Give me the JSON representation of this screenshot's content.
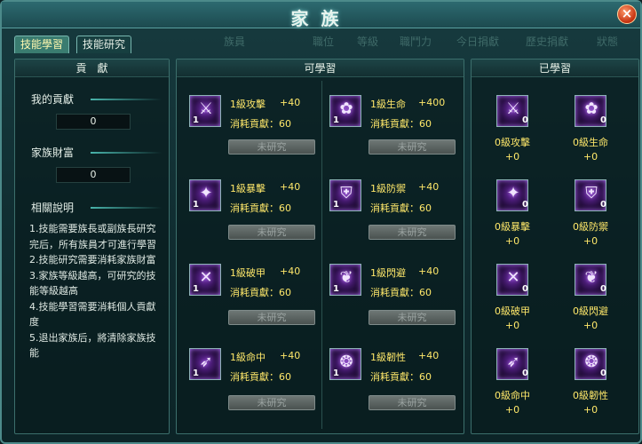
{
  "window": {
    "title": "家族",
    "close_label": "×"
  },
  "tabs": [
    {
      "label": "技能學習",
      "active": true
    },
    {
      "label": "技能研究",
      "active": false
    }
  ],
  "header_columns": [
    "族員",
    "職位",
    "等級",
    "職鬥力",
    "今日捐獻",
    "歷史捐獻",
    "狀態"
  ],
  "left": {
    "title": "貢　獻",
    "my_contribution_label": "我的貢獻",
    "my_contribution_value": "0",
    "family_wealth_label": "家族財富",
    "family_wealth_value": "0",
    "notes_label": "相關說明",
    "notes": [
      "1.技能需要族長或副族長研究完后，所有族員才可進行學習",
      "2.技能研究需要消耗家族財富",
      "3.家族等級越高，可研究的技能等級越高",
      "4.技能學習需要消耗個人貢獻度",
      "5.退出家族后，將清除家族技能"
    ]
  },
  "learnable": {
    "title": "可學習",
    "cost_label": "消耗貢獻：60",
    "button_label": "未研究",
    "skills": [
      {
        "name": "1級攻擊",
        "bonus": "+40",
        "count": "1",
        "glyph": "⚔",
        "icon": "blade-icon"
      },
      {
        "name": "1級生命",
        "bonus": "+400",
        "count": "1",
        "glyph": "✿",
        "icon": "heart-orb-icon"
      },
      {
        "name": "1級暴擊",
        "bonus": "+40",
        "count": "1",
        "glyph": "✦",
        "icon": "crit-icon"
      },
      {
        "name": "1級防禦",
        "bonus": "+40",
        "count": "1",
        "glyph": "⛨",
        "icon": "armor-icon"
      },
      {
        "name": "1級破甲",
        "bonus": "+40",
        "count": "1",
        "glyph": "✕",
        "icon": "pierce-icon"
      },
      {
        "name": "1級閃避",
        "bonus": "+40",
        "count": "1",
        "glyph": "❦",
        "icon": "wing-icon"
      },
      {
        "name": "1級命中",
        "bonus": "+40",
        "count": "1",
        "glyph": "➶",
        "icon": "hit-icon"
      },
      {
        "name": "1級韌性",
        "bonus": "+40",
        "count": "1",
        "glyph": "❂",
        "icon": "star-shield-icon"
      }
    ]
  },
  "learned": {
    "title": "已學習",
    "skills": [
      {
        "name": "0級攻擊",
        "bonus": "+0",
        "count": "0",
        "glyph": "⚔",
        "icon": "blade-icon"
      },
      {
        "name": "0級生命",
        "bonus": "+0",
        "count": "0",
        "glyph": "✿",
        "icon": "heart-orb-icon"
      },
      {
        "name": "0級暴擊",
        "bonus": "+0",
        "count": "0",
        "glyph": "✦",
        "icon": "crit-icon"
      },
      {
        "name": "0級防禦",
        "bonus": "+0",
        "count": "0",
        "glyph": "⛨",
        "icon": "armor-icon"
      },
      {
        "name": "0級破甲",
        "bonus": "+0",
        "count": "0",
        "glyph": "✕",
        "icon": "pierce-icon"
      },
      {
        "name": "0級閃避",
        "bonus": "+0",
        "count": "0",
        "glyph": "❦",
        "icon": "wing-icon"
      },
      {
        "name": "0級命中",
        "bonus": "+0",
        "count": "0",
        "glyph": "➶",
        "icon": "hit-icon"
      },
      {
        "name": "0級韌性",
        "bonus": "+0",
        "count": "0",
        "glyph": "❂",
        "icon": "star-shield-icon"
      }
    ]
  },
  "colors": {
    "accent": "#ffe86a",
    "panel_border": "#3c6f6c",
    "tab_active": "#3a7c70"
  }
}
